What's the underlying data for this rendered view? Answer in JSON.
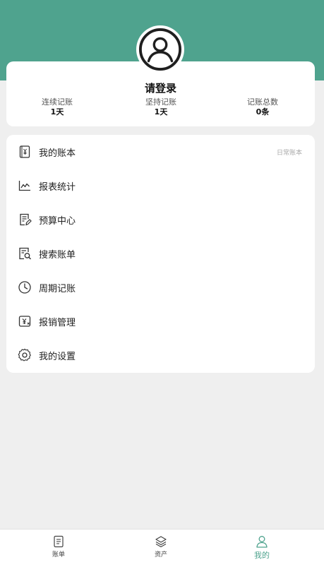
{
  "profile": {
    "title": "请登录",
    "stats": [
      {
        "label": "连续记账",
        "value": "1天"
      },
      {
        "label": "坚持记账",
        "value": "1天"
      },
      {
        "label": "记账总数",
        "value": "0条"
      }
    ]
  },
  "menu": {
    "items": [
      {
        "icon": "ledger-icon",
        "label": "我的账本",
        "hint": "日常账本"
      },
      {
        "icon": "chart-icon",
        "label": "报表统计"
      },
      {
        "icon": "budget-icon",
        "label": "预算中心"
      },
      {
        "icon": "search-bill-icon",
        "label": "搜索账单"
      },
      {
        "icon": "clock-icon",
        "label": "周期记账"
      },
      {
        "icon": "reimburse-icon",
        "label": "报销管理"
      },
      {
        "icon": "gear-icon",
        "label": "我的设置"
      }
    ]
  },
  "tabbar": {
    "items": [
      {
        "icon": "bill-icon",
        "label": "账单"
      },
      {
        "icon": "layers-icon",
        "label": "资产"
      },
      {
        "icon": "user-icon",
        "label": "我的"
      }
    ],
    "active_index": 2
  },
  "colors": {
    "accent": "#4fa38e",
    "background": "#efefef",
    "card": "#ffffff"
  }
}
